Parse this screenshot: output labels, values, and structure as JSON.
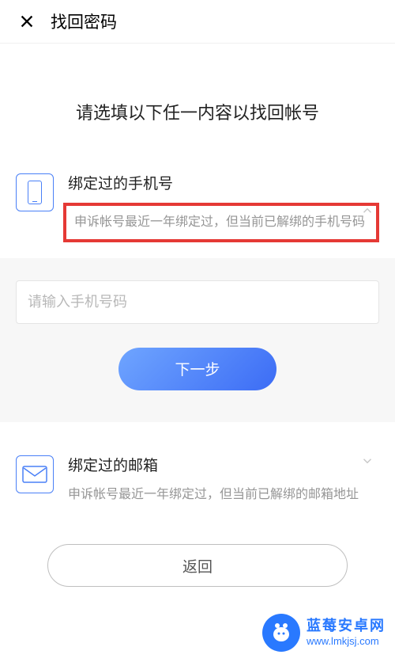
{
  "header": {
    "title": "找回密码"
  },
  "pageTitle": "请选填以下任一内容以找回帐号",
  "phoneOption": {
    "title": "绑定过的手机号",
    "description": "申诉帐号最近一年绑定过，但当前已解绑的手机号码"
  },
  "phoneInput": {
    "placeholder": "请输入手机号码"
  },
  "nextButton": "下一步",
  "emailOption": {
    "title": "绑定过的邮箱",
    "description": "申诉帐号最近一年绑定过，但当前已解绑的邮箱地址"
  },
  "returnButton": "返回",
  "watermark": {
    "line1": "蓝莓安卓网",
    "line2": "www.lmkjsj.com"
  }
}
